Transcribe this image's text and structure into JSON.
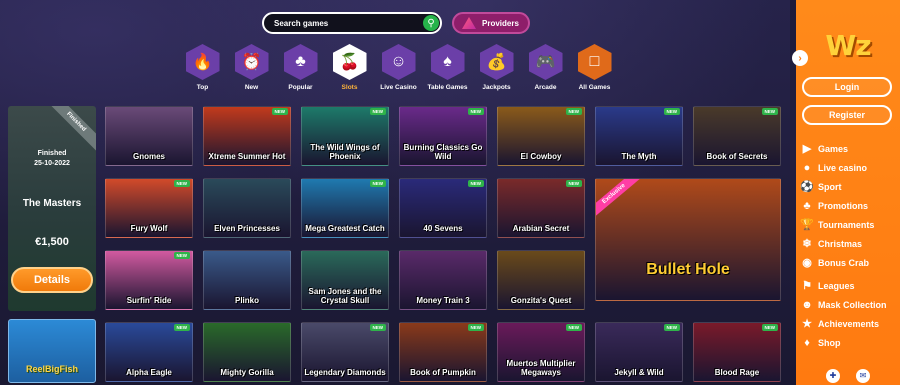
{
  "search": {
    "placeholder": "Search games"
  },
  "providers": {
    "label": "Providers"
  },
  "categories": [
    {
      "label": "Top",
      "icon": "fire-icon",
      "color": "#7a3fb5"
    },
    {
      "label": "New",
      "icon": "clock-icon",
      "color": "#7a3fb5"
    },
    {
      "label": "Popular",
      "icon": "clover-icon",
      "color": "#7a3fb5"
    },
    {
      "label": "Slots",
      "icon": "cherry-icon",
      "color": "#ffffff"
    },
    {
      "label": "Live Casino",
      "icon": "dealer-icon",
      "color": "#7a3fb5"
    },
    {
      "label": "Table Games",
      "icon": "cards-icon",
      "color": "#7a3fb5"
    },
    {
      "label": "Jackpots",
      "icon": "moneybag-icon",
      "color": "#7a3fb5"
    },
    {
      "label": "Arcade",
      "icon": "joystick-icon",
      "color": "#7a3fb5"
    },
    {
      "label": "All Games",
      "icon": "allgames-icon",
      "color": "#7a3fb5"
    }
  ],
  "tournament": {
    "ribbon": "Finished",
    "status": "Finished",
    "date": "25-10-2022",
    "name": "The Masters",
    "prize": "€1,500",
    "button": "Details"
  },
  "mini_game": {
    "title": "ReelBigFish"
  },
  "games": [
    {
      "name": "Gnomes",
      "new": false,
      "bg": "#6a4a78"
    },
    {
      "name": "Xtreme Summer Hot",
      "new": true,
      "bg": "#c23a1c"
    },
    {
      "name": "The Wild Wings of Phoenix",
      "new": true,
      "bg": "#1d7a6a"
    },
    {
      "name": "Burning Classics Go Wild",
      "new": true,
      "bg": "#6a2a8a"
    },
    {
      "name": "El Cowboy",
      "new": true,
      "bg": "#8a5a1a"
    },
    {
      "name": "The Myth",
      "new": true,
      "bg": "#2a3a8a"
    },
    {
      "name": "Book of Secrets",
      "new": true,
      "bg": "#4a3a2a"
    },
    {
      "name": "Fury Wolf",
      "new": true,
      "bg": "#d24a2a"
    },
    {
      "name": "Elven Princesses",
      "new": false,
      "bg": "#2a4a5a"
    },
    {
      "name": "Mega Greatest Catch",
      "new": true,
      "bg": "#1f7ab0"
    },
    {
      "name": "40 Sevens",
      "new": true,
      "bg": "#2a2a7a"
    },
    {
      "name": "Arabian Secret",
      "new": true,
      "bg": "#7a2a2a"
    },
    {
      "name": "Bullet Hole",
      "new": false,
      "bg": "#b04a1a",
      "big": true,
      "exclusive": "Exclusive"
    },
    {
      "name": "Surfin' Ride",
      "new": true,
      "bg": "#d25aa0"
    },
    {
      "name": "Plinko",
      "new": false,
      "bg": "#3a5a8a"
    },
    {
      "name": "Sam Jones and the Crystal Skull",
      "new": false,
      "bg": "#2a6a5a"
    },
    {
      "name": "Money Train 3",
      "new": false,
      "bg": "#5a2a6a"
    },
    {
      "name": "Gonzita's Quest",
      "new": false,
      "bg": "#6a4a1a"
    },
    {
      "name": "Alpha Eagle",
      "new": true,
      "bg": "#2a4a9a"
    },
    {
      "name": "Mighty Gorilla",
      "new": false,
      "bg": "#2a6a2a"
    },
    {
      "name": "Legendary Diamonds",
      "new": true,
      "bg": "#4a4a6a"
    },
    {
      "name": "Book of Pumpkin",
      "new": true,
      "bg": "#8a3a1a"
    },
    {
      "name": "Muertos Multiplier Megaways",
      "new": true,
      "bg": "#6a1a5a"
    },
    {
      "name": "Jekyll & Wild",
      "new": true,
      "bg": "#3a2a5a"
    },
    {
      "name": "Blood Rage",
      "new": true,
      "bg": "#7a1a2a"
    }
  ],
  "sidebar": {
    "logo": "Wz",
    "login": "Login",
    "register": "Register",
    "menu": [
      {
        "label": "Games",
        "icon": "games-icon"
      },
      {
        "label": "Live casino",
        "icon": "live-casino-icon"
      },
      {
        "label": "Sport",
        "icon": "football-icon"
      },
      {
        "label": "Promotions",
        "icon": "gift-icon"
      },
      {
        "label": "Tournaments",
        "icon": "trophy-icon"
      },
      {
        "label": "Christmas",
        "icon": "christmas-icon"
      },
      {
        "label": "Bonus Crab",
        "icon": "crab-icon"
      },
      {
        "label": "Leagues",
        "icon": "leagues-icon"
      },
      {
        "label": "Mask Collection",
        "icon": "mask-icon"
      },
      {
        "label": "Achievements",
        "icon": "achievement-icon"
      },
      {
        "label": "Shop",
        "icon": "shop-icon"
      }
    ]
  }
}
